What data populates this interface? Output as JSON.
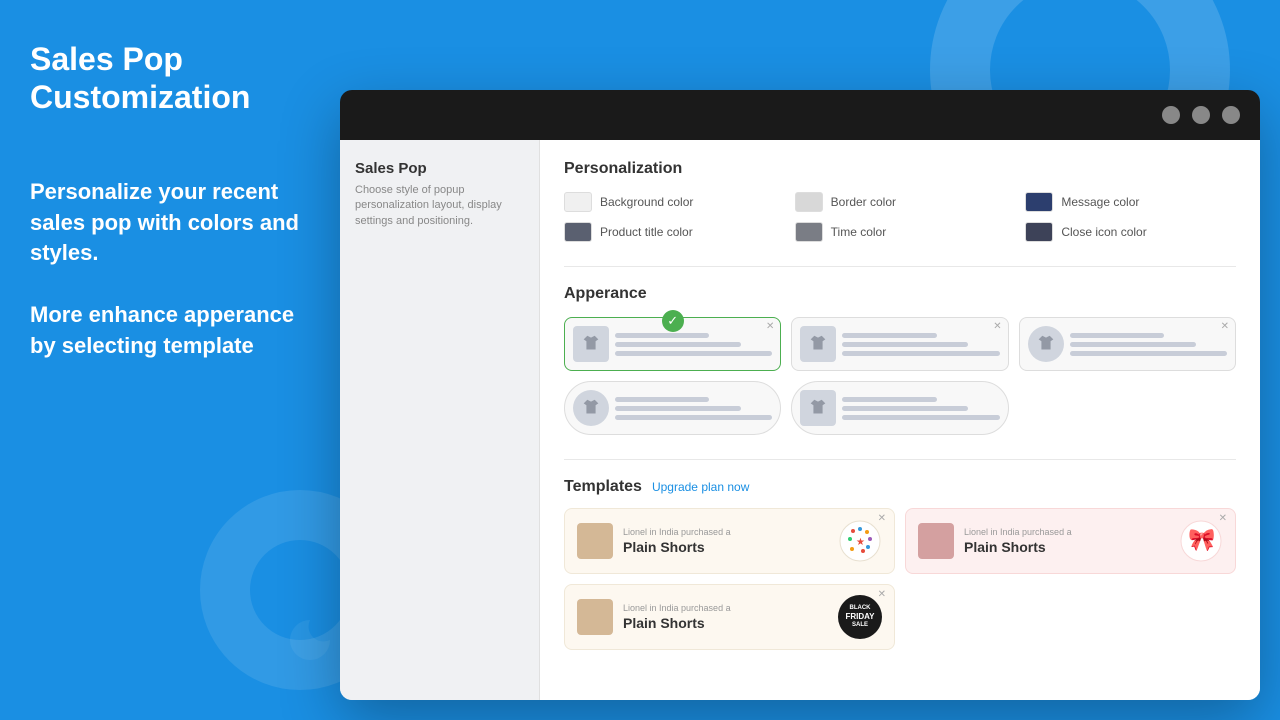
{
  "page": {
    "title": "Sales Pop Customization"
  },
  "left": {
    "title": "Sales Pop Customization",
    "desc_line1": "Personalize your recent sales pop with colors and styles.",
    "desc_line2": "More enhance apperance by selecting template"
  },
  "browser": {
    "dot1": "",
    "dot2": "",
    "dot3": ""
  },
  "sidebar": {
    "title": "Sales Pop",
    "desc": "Choose style of popup personalization layout, display settings and positioning."
  },
  "personalization": {
    "section_title": "Personalization",
    "colors": [
      {
        "label": "Background color",
        "color": "#f0f0f0"
      },
      {
        "label": "Border color",
        "color": "#d8d8d8"
      },
      {
        "label": "Message color",
        "color": "#2c3e6e"
      },
      {
        "label": "Product title color",
        "color": "#5a6070"
      },
      {
        "label": "Time color",
        "color": "#7a7d85"
      },
      {
        "label": "Close icon color",
        "color": "#3d4258"
      }
    ]
  },
  "appearance": {
    "section_title": "Apperance",
    "templates": [
      {
        "id": 1,
        "selected": true,
        "style": "normal"
      },
      {
        "id": 2,
        "selected": false,
        "style": "normal"
      },
      {
        "id": 3,
        "selected": false,
        "style": "circle-icon"
      },
      {
        "id": 4,
        "selected": false,
        "style": "rounded"
      },
      {
        "id": 5,
        "selected": false,
        "style": "rounded-square"
      }
    ]
  },
  "templates": {
    "section_title": "Templates",
    "upgrade_label": "Upgrade plan now",
    "cards": [
      {
        "id": 1,
        "subtitle": "Lionel in India purchased a",
        "name": "Plain Shorts",
        "badge_type": "confetti",
        "variant": "default"
      },
      {
        "id": 2,
        "subtitle": "Lionel in India purchased a",
        "name": "Plain Shorts",
        "badge_type": "flowers",
        "variant": "pink"
      },
      {
        "id": 3,
        "subtitle": "Lionel in India purchased a",
        "name": "Plain Shorts",
        "badge_type": "blackfriday",
        "variant": "default"
      }
    ]
  }
}
